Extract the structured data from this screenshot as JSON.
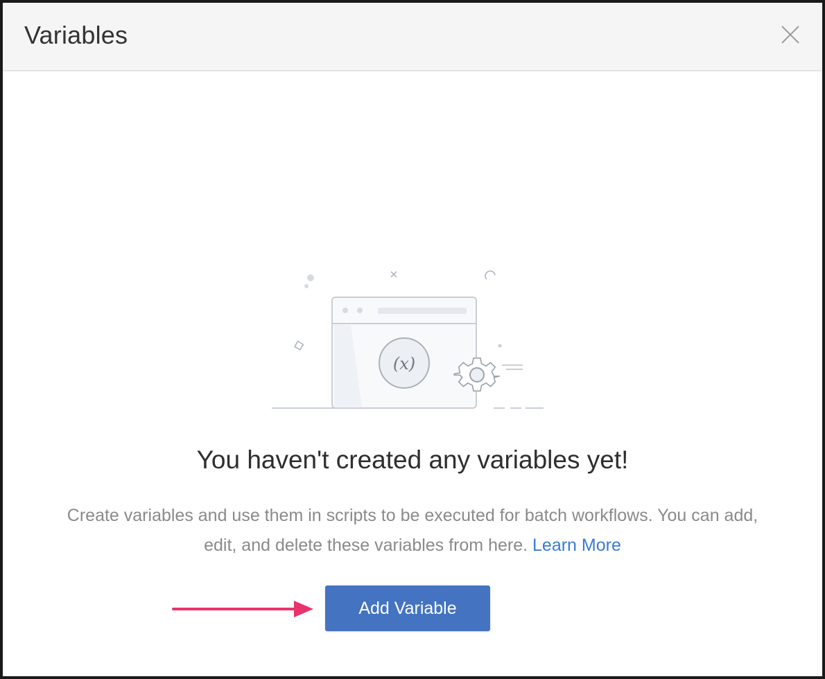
{
  "modal": {
    "title": "Variables",
    "close_icon": "close-icon"
  },
  "empty_state": {
    "illustration_icon": "variable-window-gear-illustration",
    "formula_symbol": "(x)",
    "heading": "You haven't created any variables yet!",
    "description_line1": "Create variables and use them in scripts to be executed for batch workflows. You can add,",
    "description_line2": "edit, and delete these variables from here.",
    "learn_more": "Learn More"
  },
  "actions": {
    "add_variable_label": "Add Variable"
  },
  "colors": {
    "primary_button": "#4474c1",
    "link": "#3a7bd5",
    "annotation_arrow": "#e8336b",
    "header_bg": "#f5f5f5"
  }
}
